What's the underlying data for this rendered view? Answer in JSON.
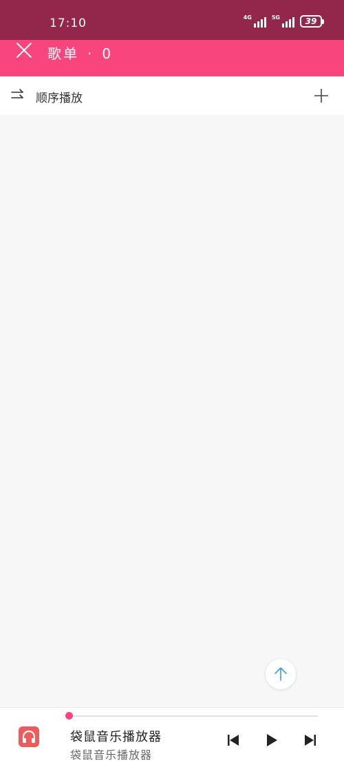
{
  "status_bar": {
    "time": "17:10",
    "network1": "4G",
    "network2": "5G",
    "battery": "39"
  },
  "header": {
    "title": "歌单",
    "separator": "·",
    "count": "0"
  },
  "toolbar": {
    "play_mode_label": "顺序播放"
  },
  "player": {
    "track_title": "袋鼠音乐播放器",
    "track_artist": "袋鼠音乐播放器",
    "progress": 0
  },
  "colors": {
    "status_bar": "#93264b",
    "accent": "#f8457e",
    "album_art": "#ef5a5a",
    "scroll_top_arrow": "#3aa0d8"
  },
  "icons": {
    "close": "close-icon",
    "play_mode": "sequential-play-icon",
    "add": "plus-icon",
    "scroll_top": "arrow-up-icon",
    "album_art": "headphones-icon",
    "prev": "skip-previous-icon",
    "play": "play-icon",
    "next": "skip-next-icon"
  }
}
